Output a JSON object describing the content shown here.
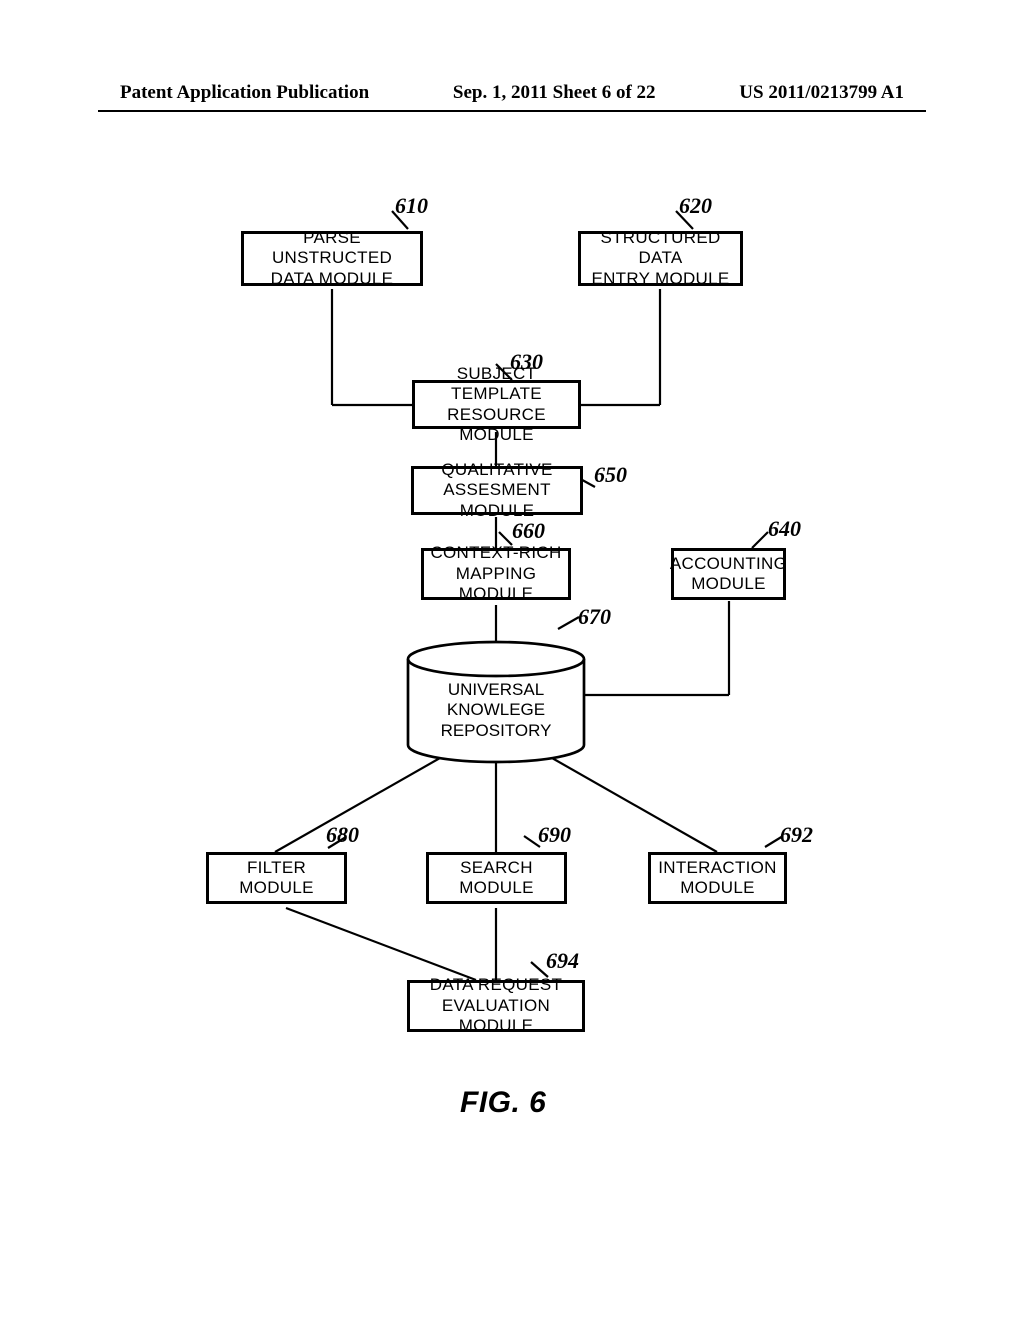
{
  "header": {
    "left": "Patent Application Publication",
    "center": "Sep. 1, 2011  Sheet 6 of 22",
    "right": "US 2011/0213799 A1"
  },
  "modules": {
    "m610": {
      "line1": "PARSE UNSTRUCTED",
      "line2": "DATA MODULE"
    },
    "m620": {
      "line1": "STRUCTURED DATA",
      "line2": "ENTRY MODULE"
    },
    "m630": {
      "line1": "SUBJECT TEMPLATE",
      "line2": "RESOURCE MODULE"
    },
    "m650": {
      "line1": "QUALITATIVE",
      "line2": "ASSESMENT MODULE"
    },
    "m660": {
      "line1": "CONTEXT-RICH",
      "line2": "MAPPING MODULE"
    },
    "m640": {
      "line1": "ACCOUNTING",
      "line2": "MODULE"
    },
    "m670": {
      "line1": "UNIVERSAL KNOWLEGE",
      "line2": "REPOSITORY"
    },
    "m680": {
      "line1": "FILTER",
      "line2": "MODULE"
    },
    "m690": {
      "line1": "SEARCH",
      "line2": "MODULE"
    },
    "m692": {
      "line1": "INTERACTION",
      "line2": "MODULE"
    },
    "m694": {
      "line1": "DATA REQUEST",
      "line2": "EVALUATION MODULE"
    }
  },
  "refs": {
    "r610": "610",
    "r620": "620",
    "r630": "630",
    "r650": "650",
    "r640": "640",
    "r660": "660",
    "r670": "670",
    "r680": "680",
    "r690": "690",
    "r692": "692",
    "r694": "694"
  },
  "figure_caption": "FIG. 6"
}
